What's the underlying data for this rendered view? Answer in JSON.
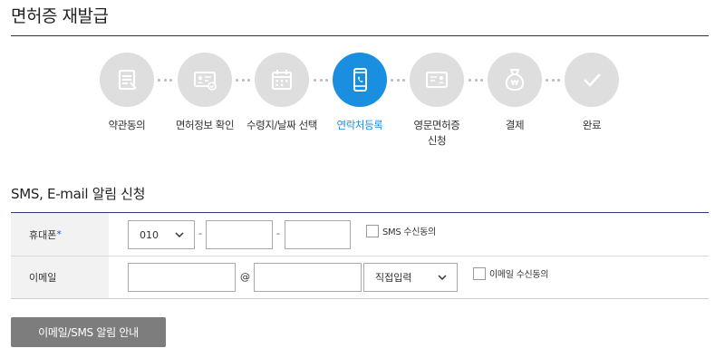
{
  "page": {
    "title": "면허증 재발급"
  },
  "steps": [
    {
      "label": "약관동의",
      "icon": "document-icon",
      "active": false
    },
    {
      "label": "면허정보 확인",
      "icon": "id-card-check-icon",
      "active": false
    },
    {
      "label": "수령지/날짜 선택",
      "icon": "calendar-icon",
      "active": false
    },
    {
      "label": "연락처등록",
      "icon": "smartphone-icon",
      "active": true
    },
    {
      "label": "영문면허증\n신청",
      "icon": "license-card-icon",
      "active": false
    },
    {
      "label": "결제",
      "icon": "money-bag-icon",
      "active": false
    },
    {
      "label": "완료",
      "icon": "checkmark-icon",
      "active": false
    }
  ],
  "section": {
    "title": "SMS, E-mail 알림 신청"
  },
  "phone": {
    "label": "휴대폰",
    "required_mark": "*",
    "prefix_value": "010",
    "separator": "-",
    "consent_label": "SMS 수신동의"
  },
  "email": {
    "label": "이메일",
    "at": "@",
    "domain_select_value": "직접입력",
    "consent_label": "이메일 수신동의"
  },
  "guide_button": {
    "label": "이메일/SMS 알림 안내"
  },
  "colors": {
    "active_step": "#1a8fe0",
    "inactive_step": "#dedede",
    "button_bg": "#7d7d7d",
    "table_top_border": "#2c3e6b"
  }
}
